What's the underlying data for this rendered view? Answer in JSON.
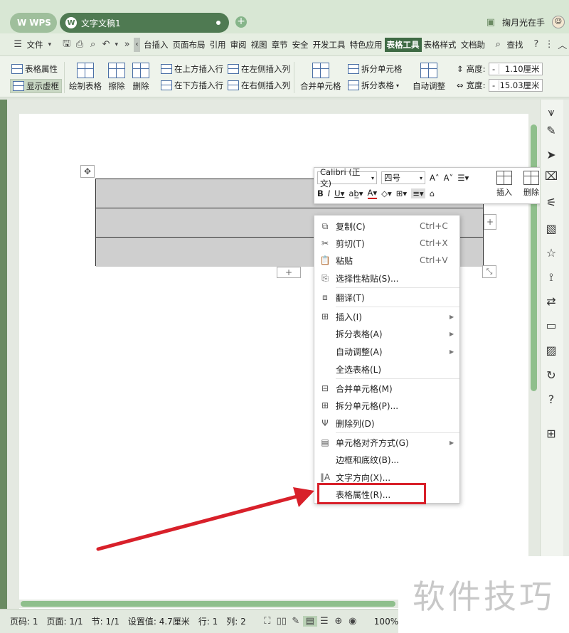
{
  "titlebar": {
    "wps_label": "WPS",
    "doc_tab": "文字文稿1",
    "new_tab": "+",
    "user_name": "掬月光在手"
  },
  "menubar": {
    "file": "文件",
    "items": [
      "台插入",
      "页面布局",
      "引用",
      "审阅",
      "视图",
      "章节",
      "安全",
      "开发工具",
      "特色应用",
      "表格工具",
      "表格样式",
      "文档助"
    ],
    "active_index": 9,
    "search": "查找"
  },
  "ribbon": {
    "table_props": "表格属性",
    "show_grid": "显示虚框",
    "draw_table": "绘制表格",
    "erase": "擦除",
    "delete": "删除",
    "insert_above": "在上方插入行",
    "insert_below": "在下方插入行",
    "insert_left": "在左侧插入列",
    "insert_right": "在右侧插入列",
    "merge_cells": "合并单元格",
    "split_cells": "拆分单元格",
    "split_table": "拆分表格",
    "auto_fit": "自动调整",
    "height_label": "高度:",
    "height_value": "1.10厘米",
    "width_label": "宽度:",
    "width_value": "15.03厘米"
  },
  "mini_toolbar": {
    "font": "Calibri (正文)",
    "size": "四号",
    "insert": "插入",
    "delete": "删除"
  },
  "context_menu": [
    {
      "icon": "copy-icon",
      "label": "复制(C)",
      "shortcut": "Ctrl+C"
    },
    {
      "icon": "cut-icon",
      "label": "剪切(T)",
      "shortcut": "Ctrl+X"
    },
    {
      "icon": "paste-icon",
      "label": "粘贴",
      "shortcut": "Ctrl+V"
    },
    {
      "icon": "paste-special-icon",
      "label": "选择性粘贴(S)..."
    },
    {
      "icon": "translate-icon",
      "label": "翻译(T)"
    },
    {
      "icon": "insert-icon",
      "label": "插入(I)"
    },
    {
      "label": "拆分表格(A)"
    },
    {
      "label": "自动调整(A)"
    },
    {
      "label": "全选表格(L)"
    },
    {
      "icon": "merge-cells-icon",
      "label": "合并单元格(M)"
    },
    {
      "icon": "split-cells-icon",
      "label": "拆分单元格(P)..."
    },
    {
      "icon": "delete-column-icon",
      "label": "删除列(D)"
    },
    {
      "icon": "cell-align-icon",
      "label": "单元格对齐方式(G)"
    },
    {
      "label": "边框和底纹(B)..."
    },
    {
      "icon": "text-direction-icon",
      "label": "文字方向(X)..."
    },
    {
      "label": "表格属性(R)..."
    }
  ],
  "statusbar": {
    "page_num": "页码: 1",
    "pages": "页面: 1/1",
    "section": "节: 1/1",
    "setting": "设置值: 4.7厘米",
    "row": "行: 1",
    "col": "列: 2",
    "zoom": "100%"
  },
  "watermark": "软件技巧",
  "colors": {
    "accent": "#3e6a44",
    "highlight_box": "#d8202a",
    "arrow": "#d8202a"
  }
}
